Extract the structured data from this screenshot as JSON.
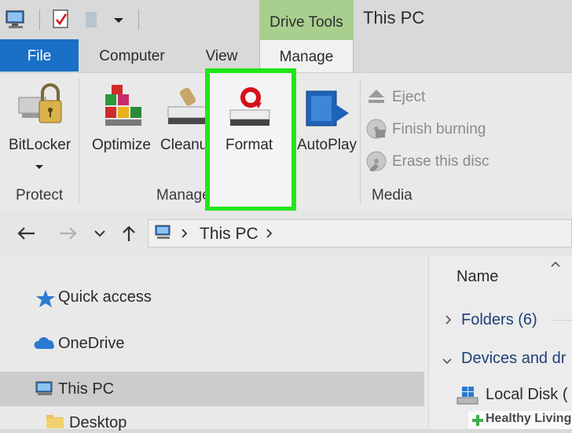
{
  "titlebar": {
    "contextual_tab_group": "Drive Tools",
    "window_title": "This PC"
  },
  "tabs": {
    "file": "File",
    "computer": "Computer",
    "view": "View",
    "manage": "Manage"
  },
  "ribbon": {
    "protect": {
      "bitlocker": "BitLocker",
      "group": "Protect"
    },
    "manage": {
      "optimize": "Optimize",
      "cleanup": "Cleanu",
      "format": "Format",
      "group": "Manage"
    },
    "media": {
      "autoplay": "AutoPlay",
      "eject": "Eject",
      "finish_burning": "Finish burning",
      "erase_disc": "Erase this disc",
      "group": "Media"
    }
  },
  "address": {
    "path_item": "This PC"
  },
  "navpane": {
    "quick_access": "Quick access",
    "onedrive": "OneDrive",
    "this_pc": "This PC",
    "desktop": "Desktop"
  },
  "content": {
    "column_name": "Name",
    "folders_group": "Folders (6)",
    "devices_group": "Devices and dr",
    "local_disk": "Local Disk ("
  },
  "watermark": {
    "text": "Healthy Living"
  },
  "colors": {
    "file_tab": "#1a6fc6",
    "drive_tools": "#a9cf8e",
    "highlight": "#22e51a"
  }
}
